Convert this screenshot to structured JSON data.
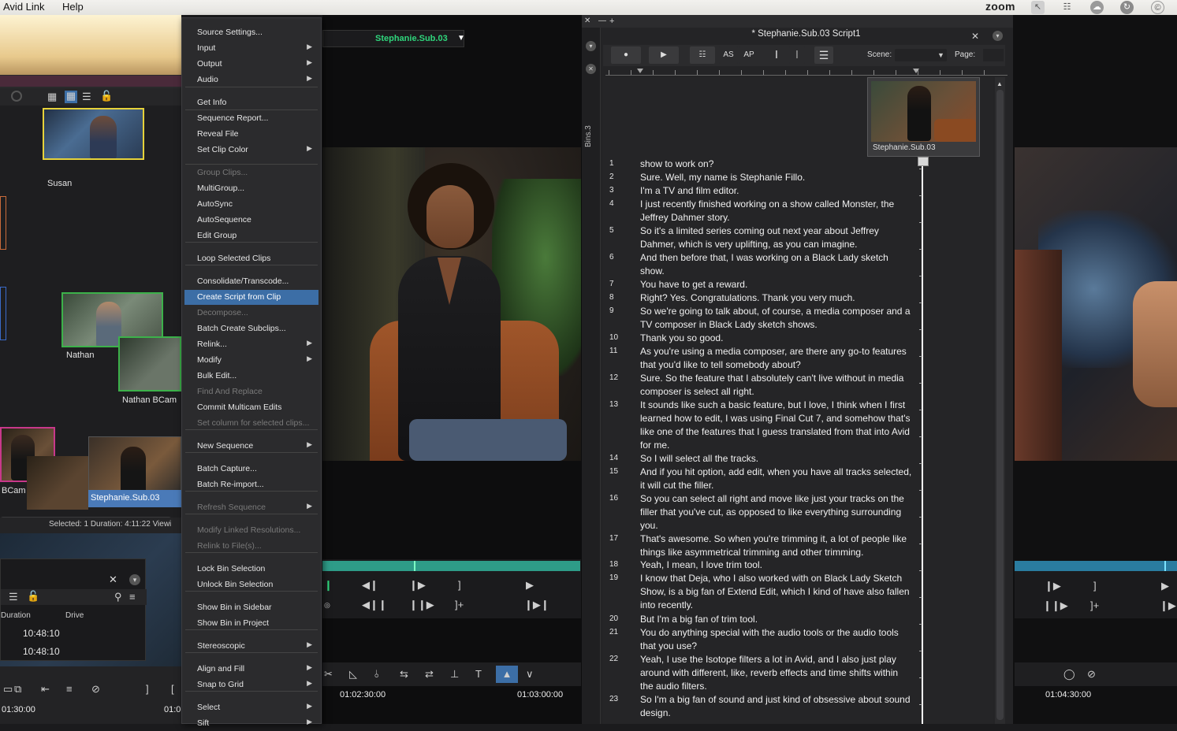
{
  "menubar": {
    "app_items": [
      "Avid Link",
      "Help"
    ],
    "zoom_label": "zoom"
  },
  "left_bin": {
    "clips": [
      {
        "name": "Susan"
      },
      {
        "name": "Nathan"
      },
      {
        "name": "Nathan  BCam"
      },
      {
        "name": "BCam"
      },
      {
        "name": "Stephanie.Sub.03"
      }
    ],
    "status": "Selected: 1  Duration: 4:11:22   Viewi",
    "bin2": {
      "columns": [
        "Duration",
        "Drive"
      ],
      "rows": [
        "10:48:10",
        "10:48:10"
      ]
    },
    "timecode": "01:30:00",
    "timecode2": "01:0"
  },
  "context_menu": {
    "items": [
      {
        "label": "Source Settings...",
        "submenu": false,
        "disabled": false
      },
      {
        "label": "Input",
        "submenu": true,
        "disabled": false
      },
      {
        "label": "Output",
        "submenu": true,
        "disabled": false
      },
      {
        "label": "Audio",
        "submenu": true,
        "disabled": false
      },
      {
        "label": "Get Info",
        "submenu": false,
        "disabled": false
      },
      {
        "label": "Sequence Report...",
        "submenu": false,
        "disabled": false
      },
      {
        "label": "Reveal File",
        "submenu": false,
        "disabled": false
      },
      {
        "label": "Set Clip Color",
        "submenu": true,
        "disabled": false
      },
      {
        "label": "Group Clips...",
        "submenu": false,
        "disabled": true
      },
      {
        "label": "MultiGroup...",
        "submenu": false,
        "disabled": false
      },
      {
        "label": "AutoSync",
        "submenu": false,
        "disabled": false
      },
      {
        "label": "AutoSequence",
        "submenu": false,
        "disabled": false
      },
      {
        "label": "Edit Group",
        "submenu": false,
        "disabled": false
      },
      {
        "label": "Loop Selected Clips",
        "submenu": false,
        "disabled": false
      },
      {
        "label": "Consolidate/Transcode...",
        "submenu": false,
        "disabled": false
      },
      {
        "label": "Create Script from Clip",
        "submenu": false,
        "disabled": false,
        "highlighted": true
      },
      {
        "label": "Decompose...",
        "submenu": false,
        "disabled": true
      },
      {
        "label": "Batch Create Subclips...",
        "submenu": false,
        "disabled": false
      },
      {
        "label": "Relink...",
        "submenu": true,
        "disabled": false
      },
      {
        "label": "Modify",
        "submenu": true,
        "disabled": false
      },
      {
        "label": "Bulk Edit...",
        "submenu": false,
        "disabled": false
      },
      {
        "label": "Find And Replace",
        "submenu": false,
        "disabled": true
      },
      {
        "label": "Commit Multicam Edits",
        "submenu": false,
        "disabled": false
      },
      {
        "label": "Set column for selected clips...",
        "submenu": false,
        "disabled": true
      },
      {
        "label": "New Sequence",
        "submenu": true,
        "disabled": false
      },
      {
        "label": "Batch Capture...",
        "submenu": false,
        "disabled": false
      },
      {
        "label": "Batch Re-import...",
        "submenu": false,
        "disabled": false
      },
      {
        "label": "Refresh Sequence",
        "submenu": true,
        "disabled": true
      },
      {
        "label": "Modify Linked Resolutions...",
        "submenu": false,
        "disabled": true
      },
      {
        "label": "Relink to File(s)...",
        "submenu": false,
        "disabled": true
      },
      {
        "label": "Lock Bin Selection",
        "submenu": false,
        "disabled": false
      },
      {
        "label": "Unlock Bin Selection",
        "submenu": false,
        "disabled": false
      },
      {
        "label": "Show Bin in Sidebar",
        "submenu": false,
        "disabled": false
      },
      {
        "label": "Show Bin in Project",
        "submenu": false,
        "disabled": false
      },
      {
        "label": "Stereoscopic",
        "submenu": true,
        "disabled": false
      },
      {
        "label": "Align and Fill",
        "submenu": true,
        "disabled": false
      },
      {
        "label": "Snap to Grid",
        "submenu": true,
        "disabled": false
      },
      {
        "label": "Select",
        "submenu": true,
        "disabled": false
      },
      {
        "label": "Sift",
        "submenu": true,
        "disabled": false
      }
    ]
  },
  "source_monitor": {
    "clip_name": "Stephanie.Sub.03",
    "timecodes": [
      "01:02:30:00",
      "01:03:00:00"
    ]
  },
  "script": {
    "title": "* Stephanie.Sub.03 Script1",
    "bins_tab": "Bins.3",
    "toolbar": {
      "as": "AS",
      "ap": "AP",
      "scene_label": "Scene:",
      "page_label": "Page:"
    },
    "thumbnail_caption": "Stephanie.Sub.03",
    "lines": [
      {
        "n": "1",
        "text": "show to work on?"
      },
      {
        "n": "2",
        "text": "Sure. Well, my name is Stephanie Fillo."
      },
      {
        "n": "3",
        "text": "I'm a TV and film editor."
      },
      {
        "n": "4",
        "text": "I just recently finished working on a show called Monster, the Jeffrey Dahmer story."
      },
      {
        "n": "5",
        "text": "So it's a limited series coming out next year about Jeffrey Dahmer, which is very uplifting, as you can imagine."
      },
      {
        "n": "6",
        "text": "And then before that, I was working on a Black Lady sketch show."
      },
      {
        "n": "7",
        "text": "You have to get a reward."
      },
      {
        "n": "8",
        "text": "Right? Yes. Congratulations. Thank you very much."
      },
      {
        "n": "9",
        "text": "So we're going to talk about, of course, a media composer and a TV composer in Black Lady sketch shows."
      },
      {
        "n": "10",
        "text": "Thank you so good."
      },
      {
        "n": "11",
        "text": "As you're using a media composer, are there any go-to features that you'd like to tell somebody about?"
      },
      {
        "n": "12",
        "text": "Sure. So the feature that I absolutely can't live without in media composer is select all right."
      },
      {
        "n": "13",
        "text": "It sounds like such a basic feature, but I love, I think when I first learned how to edit, I was using Final Cut 7, and somehow that's like one of the features that I guess translated from that into Avid for me."
      },
      {
        "n": "14",
        "text": "So I will select all the tracks."
      },
      {
        "n": "15",
        "text": "And if you hit option, add edit, when you have all tracks selected, it will cut the filler."
      },
      {
        "n": "16",
        "text": "So you can select all right and move like just your tracks on the filler that you've cut, as opposed to like everything surrounding you."
      },
      {
        "n": "17",
        "text": "That's awesome. So when you're trimming it, a lot of people like things like asymmetrical trimming and other trimming."
      },
      {
        "n": "18",
        "text": "Yeah, I mean, I love trim tool."
      },
      {
        "n": "19",
        "text": "I know that Deja, who I also worked with on Black Lady Sketch Show, is a big fan of Extend Edit, which I kind of have also fallen into recently."
      },
      {
        "n": "20",
        "text": "But I'm a big fan of trim tool."
      },
      {
        "n": "21",
        "text": "You do anything special with the audio tools or the audio tools that you use?"
      },
      {
        "n": "22",
        "text": "Yeah, I use the Isotope filters a lot in Avid, and I also just play around with different, like, reverb effects and time shifts within the audio filters."
      },
      {
        "n": "23",
        "text": "So I'm a big fan of sound and just kind of obsessive about sound design."
      }
    ]
  },
  "record_monitor": {
    "timecode": "01:04:30:00"
  },
  "colors": {
    "highlight": "#3c6ea6",
    "clip_green": "#2fd67c",
    "timeline_teal": "#2e9c88"
  }
}
